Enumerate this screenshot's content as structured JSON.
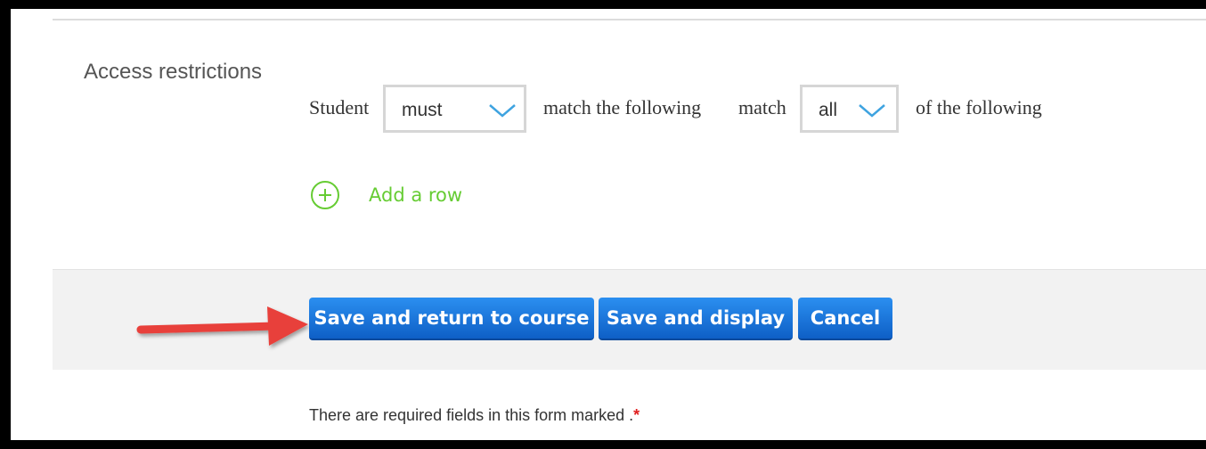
{
  "section": {
    "title": "Access restrictions"
  },
  "restriction": {
    "subject": "Student",
    "must_select": {
      "value": "must"
    },
    "middle_text": "match the following",
    "match_word": "match",
    "all_select": {
      "value": "all"
    },
    "end_text": "of the following"
  },
  "add_row": {
    "label": "Add a row"
  },
  "buttons": {
    "save_return": "Save and return to course",
    "save_display": "Save and display",
    "cancel": "Cancel"
  },
  "footer": {
    "required_text": "There are required fields in this form marked .",
    "required_marker": "*"
  },
  "colors": {
    "button_blue": "#1a73d9",
    "add_green": "#66cc33",
    "arrow_red": "#e8403a"
  }
}
